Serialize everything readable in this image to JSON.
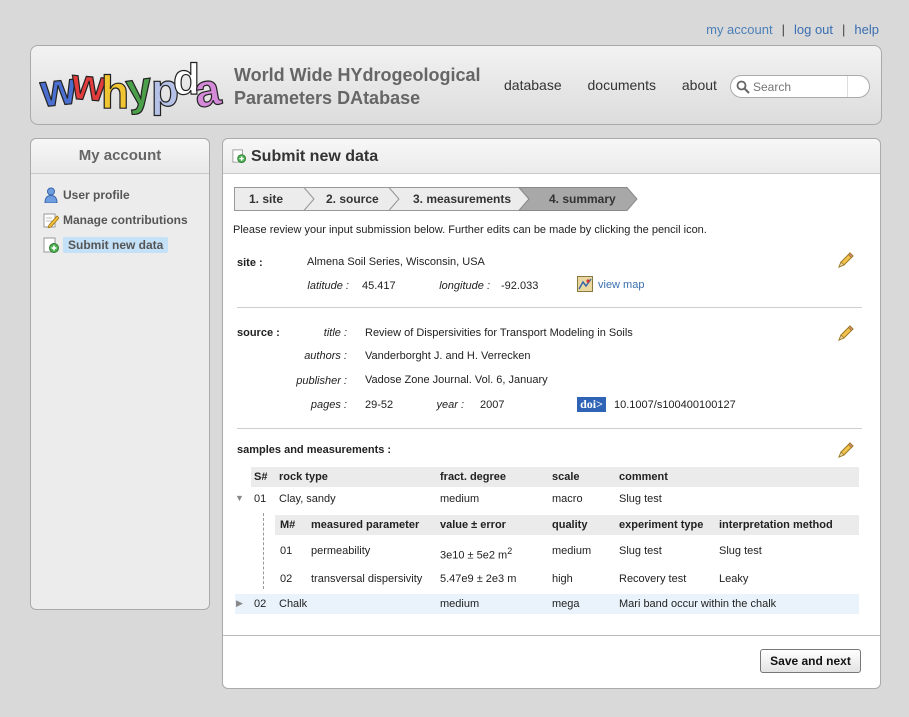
{
  "top_links": {
    "my_account": "my account",
    "log_out": "log out",
    "help": "help",
    "separator": "|"
  },
  "header": {
    "logo_text": "wwhypda",
    "title_line1": "World Wide HYdrogeological",
    "title_line2": "Parameters DAtabase",
    "nav": [
      "database",
      "documents",
      "about"
    ],
    "search_placeholder": "Search"
  },
  "sidebar": {
    "title": "My account",
    "items": [
      {
        "label": "User profile",
        "icon": "user-icon"
      },
      {
        "label": "Manage contributions",
        "icon": "pencil-note-icon"
      },
      {
        "label": "Submit new data",
        "icon": "add-document-icon",
        "selected": true
      }
    ]
  },
  "main": {
    "title": "Submit new data",
    "steps": [
      "1. site",
      "2. source",
      "3. measurements",
      "4. summary"
    ],
    "active_step": 3,
    "intro": "Please review your input submission below. Further edits can be made by clicking the pencil icon.",
    "site": {
      "label": "site :",
      "name": "Almena Soil Series, Wisconsin, USA",
      "latitude_label": "latitude :",
      "latitude": "45.417",
      "longitude_label": "longitude :",
      "longitude": "-92.033",
      "view_map": "view map"
    },
    "source": {
      "label": "source :",
      "title_label": "title :",
      "title": "Review of Dispersivities for Transport Modeling in Soils",
      "authors_label": "authors :",
      "authors": "Vanderborght J. and H. Verrecken",
      "publisher_label": "publisher :",
      "publisher": "Vadose Zone Journal. Vol. 6, January",
      "pages_label": "pages :",
      "pages": "29-52",
      "year_label": "year :",
      "year": "2007",
      "doi_badge": "doi>",
      "doi": "10.1007/s100400100127"
    },
    "samples": {
      "label": "samples and measurements :",
      "headers": [
        "S#",
        "rock type",
        "fract. degree",
        "scale",
        "comment"
      ],
      "rows": [
        {
          "num": "01",
          "rock": "Clay, sandy",
          "fract": "medium",
          "scale": "macro",
          "comment": "Slug test",
          "expanded": true
        },
        {
          "num": "02",
          "rock": "Chalk",
          "fract": "medium",
          "scale": "mega",
          "comment": "Mari band occur within the chalk",
          "expanded": false
        }
      ],
      "meas_headers": [
        "M#",
        "measured parameter",
        "value ± error",
        "quality",
        "experiment type",
        "interpretation method"
      ],
      "measurements": [
        {
          "num": "01",
          "param": "permeability",
          "value": "3e10 ± 5e2 m",
          "sup": "2",
          "quality": "medium",
          "exp": "Slug test",
          "interp": "Slug test"
        },
        {
          "num": "02",
          "param": "transversal dispersivity",
          "value": "5.47e9 ± 2e3 m",
          "sup": "",
          "quality": "high",
          "exp": "Recovery test",
          "interp": "Leaky"
        }
      ]
    },
    "save_button": "Save and next"
  }
}
